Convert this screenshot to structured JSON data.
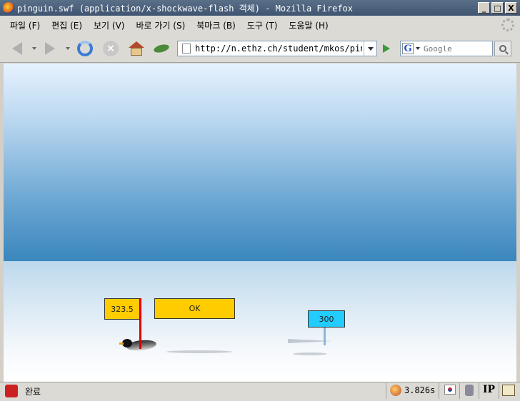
{
  "window": {
    "title": "pinguin.swf (application/x-shockwave-flash 객체) - Mozilla Firefox",
    "minimize_label": "_",
    "maximize_label": "□",
    "close_label": "X"
  },
  "menu": {
    "items": [
      {
        "label": "파일 (F)"
      },
      {
        "label": "편집 (E)"
      },
      {
        "label": "보기 (V)"
      },
      {
        "label": "바로 가기 (S)"
      },
      {
        "label": "북마크 (B)"
      },
      {
        "label": "도구 (T)"
      },
      {
        "label": "도움말 (H)"
      }
    ]
  },
  "toolbar": {
    "icons": [
      "back-arrow-icon",
      "forward-arrow-icon",
      "reload-icon",
      "stop-icon",
      "home-icon",
      "leaf-icon"
    ],
    "stop_glyph": "×",
    "url": "http://n.ethz.ch/student/mkos/pinguin.swf",
    "search_engine_glyph": "G",
    "search_placeholder": "Google"
  },
  "game": {
    "distance_sign": "323.5",
    "status_sign": "OK",
    "target_sign": "300",
    "colors": {
      "sign_yellow": "#ffcc00",
      "sign_cyan": "#22ccff",
      "pole_red": "#dd0000",
      "sky_top": "#e6f2ff",
      "sky_bottom": "#3a86bd"
    }
  },
  "statusbar": {
    "status_text": "완료",
    "timer": "3.826s",
    "ip_label": "IP"
  }
}
